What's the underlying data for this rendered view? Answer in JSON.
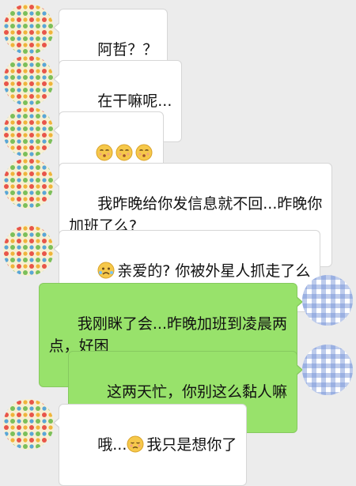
{
  "messages": [
    {
      "sender": "other",
      "text": "阿哲？？"
    },
    {
      "sender": "other",
      "text": "在干嘛呢..."
    },
    {
      "sender": "other",
      "text": "",
      "emojis": [
        "kissing-face-emoji",
        "kissing-face-emoji",
        "kissing-face-emoji"
      ]
    },
    {
      "sender": "other",
      "text": "我昨晚给你发信息就不回...昨晚你\n加班了么?"
    },
    {
      "sender": "other",
      "emoji": "crying-face-emoji",
      "text": "亲爱的? 你被外星人抓走了么"
    },
    {
      "sender": "me",
      "text": "我刚眯了会...昨晚加班到凌晨两\n点，好困"
    },
    {
      "sender": "me",
      "text": "这两天忙，你别这么黏人嘛"
    },
    {
      "sender": "other",
      "text_before": "哦...",
      "emoji": "sad-face-emoji",
      "text_after": "我只是想你了"
    }
  ],
  "colors": {
    "background": "#ececec",
    "incoming_bubble": "#ffffff",
    "outgoing_bubble": "#98e26b",
    "polka_base": "#f7efd2",
    "gingham_blue": "#6f8fd6"
  }
}
